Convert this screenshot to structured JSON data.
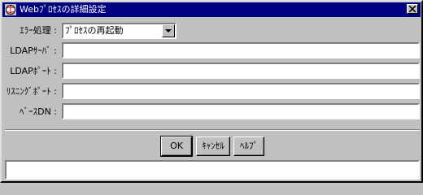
{
  "window": {
    "title": "Webﾌﾟﾛｾｽの詳細設定"
  },
  "form": {
    "error_handling_label": "ｴﾗｰ処理 :",
    "error_handling_value": "ﾌﾟﾛｾｽの再起動",
    "ldap_server_label": "LDAPｻｰﾊﾞ :",
    "ldap_server_value": "",
    "ldap_port_label": "LDAPﾎﾟｰﾄ :",
    "ldap_port_value": "",
    "listening_port_label": "ﾘｽﾆﾝｸﾞﾎﾟｰﾄ :",
    "listening_port_value": "",
    "base_dn_label": "ﾍﾞｰｽDN :",
    "base_dn_value": ""
  },
  "buttons": {
    "ok": "OK",
    "cancel": "ｷｬﾝｾﾙ",
    "help": "ﾍﾙﾌﾟ"
  },
  "status": {
    "text": ""
  },
  "colors": {
    "title_bar": "#000080",
    "face": "#c0c0c0"
  }
}
